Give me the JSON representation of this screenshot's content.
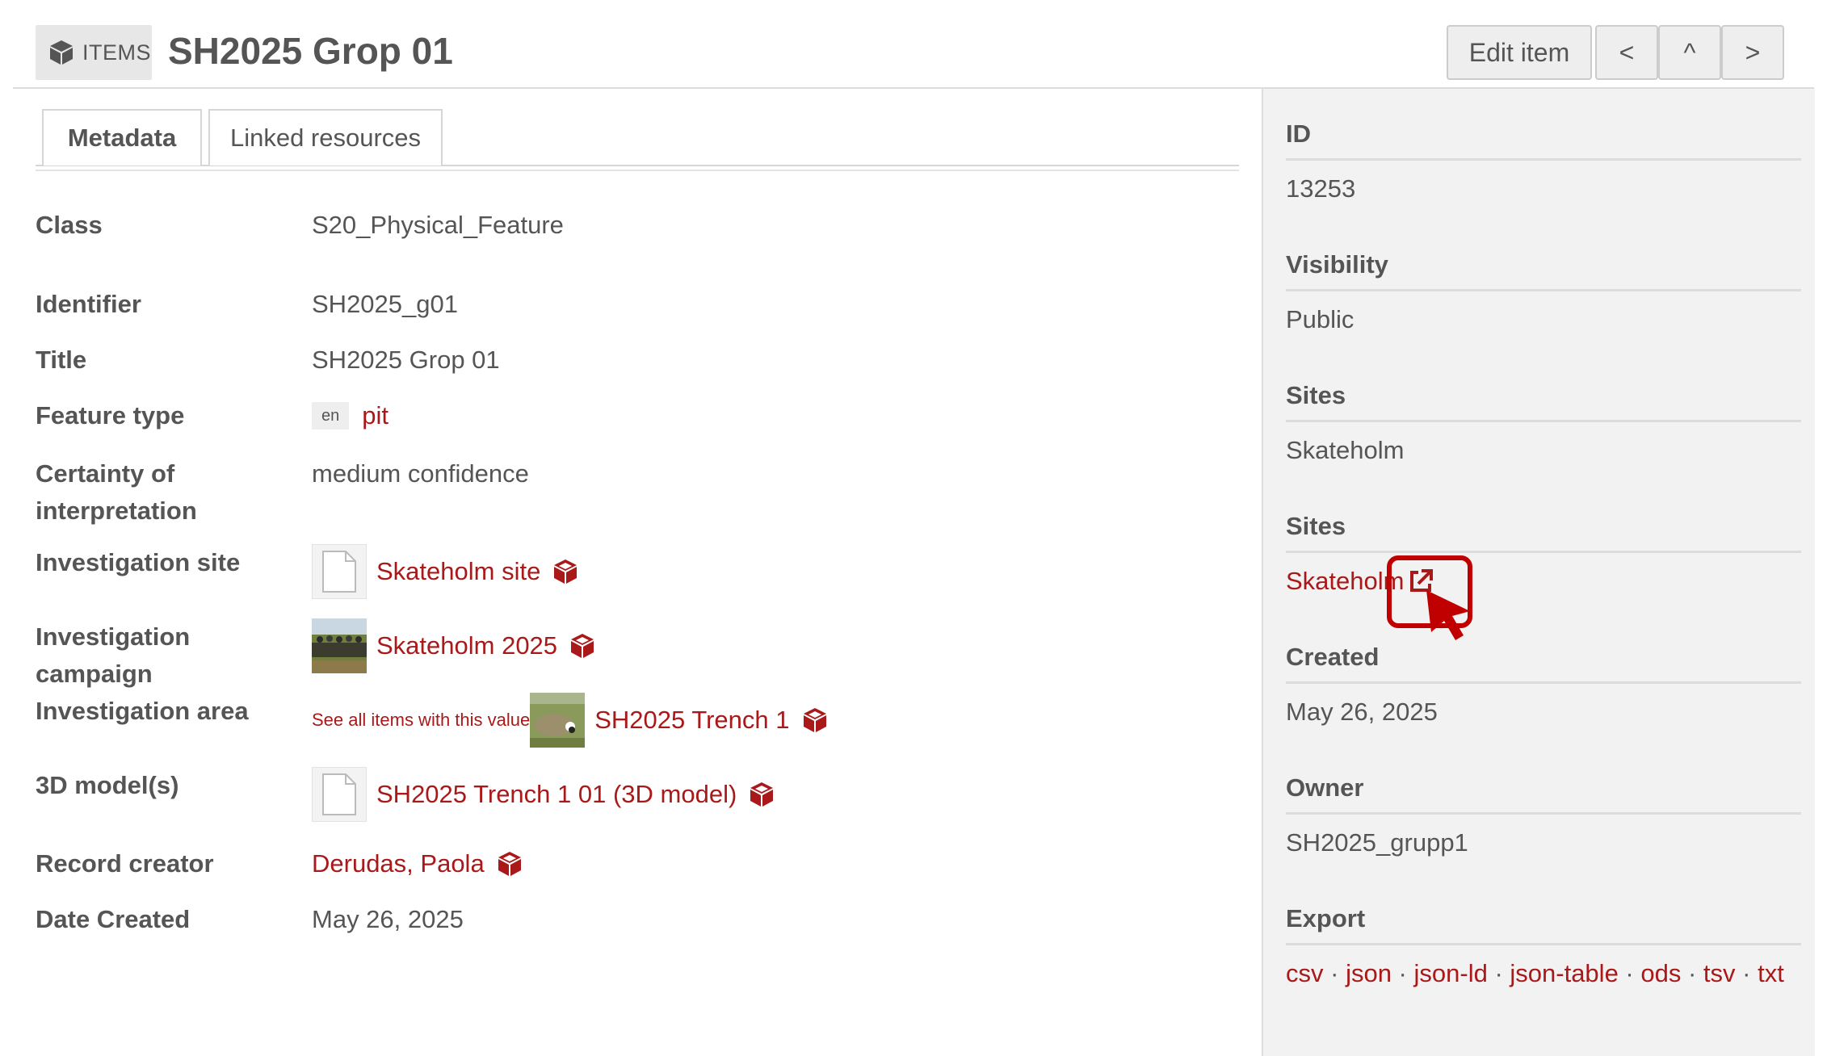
{
  "header": {
    "badge_icon": "cube-icon",
    "badge_label": "ITEMS",
    "title": "SH2025 Grop 01",
    "buttons": {
      "edit": "Edit item",
      "prev": "<",
      "up": "^",
      "next": ">"
    }
  },
  "tabs": [
    {
      "label": "Metadata",
      "active": true
    },
    {
      "label": "Linked resources",
      "active": false
    }
  ],
  "metadata": {
    "class": {
      "label": "Class",
      "value": "S20_Physical_Feature"
    },
    "identifier": {
      "label": "Identifier",
      "value": "SH2025_g01"
    },
    "title": {
      "label": "Title",
      "value": "SH2025 Grop 01"
    },
    "feature_type": {
      "label": "Feature type",
      "lang": "en",
      "value": "pit"
    },
    "certainty": {
      "label_line1": "Certainty of",
      "label_line2": "interpretation",
      "value": "medium confidence"
    },
    "investigation_site": {
      "label": "Investigation site",
      "value": "Skateholm site"
    },
    "investigation_campaign": {
      "label": "Investigation campaign",
      "value": "Skateholm 2025"
    },
    "investigation_area": {
      "label": "Investigation area",
      "see_all": "See all items with this value",
      "value": "SH2025 Trench 1"
    },
    "model_3d": {
      "label": "3D model(s)",
      "value": "SH2025 Trench 1 01 (3D model)"
    },
    "record_creator": {
      "label": "Record creator",
      "value": "Derudas, Paola"
    },
    "date_created": {
      "label": "Date Created",
      "value": "May 26, 2025"
    }
  },
  "sidebar": {
    "id": {
      "label": "ID",
      "value": "13253"
    },
    "visibility": {
      "label": "Visibility",
      "value": "Public"
    },
    "sites1": {
      "label": "Sites",
      "value": "Skateholm"
    },
    "sites2": {
      "label": "Sites",
      "value": "Skateholm"
    },
    "created": {
      "label": "Created",
      "value": "May 26, 2025"
    },
    "owner": {
      "label": "Owner",
      "value": "SH2025_grupp1"
    },
    "export": {
      "label": "Export",
      "formats": [
        "csv",
        "json",
        "json-ld",
        "json-table",
        "ods",
        "tsv",
        "txt"
      ],
      "separator": " · "
    }
  },
  "colors": {
    "link": "#a91919",
    "highlight": "#c00000",
    "sidebar_bg": "#f2f2f2"
  }
}
